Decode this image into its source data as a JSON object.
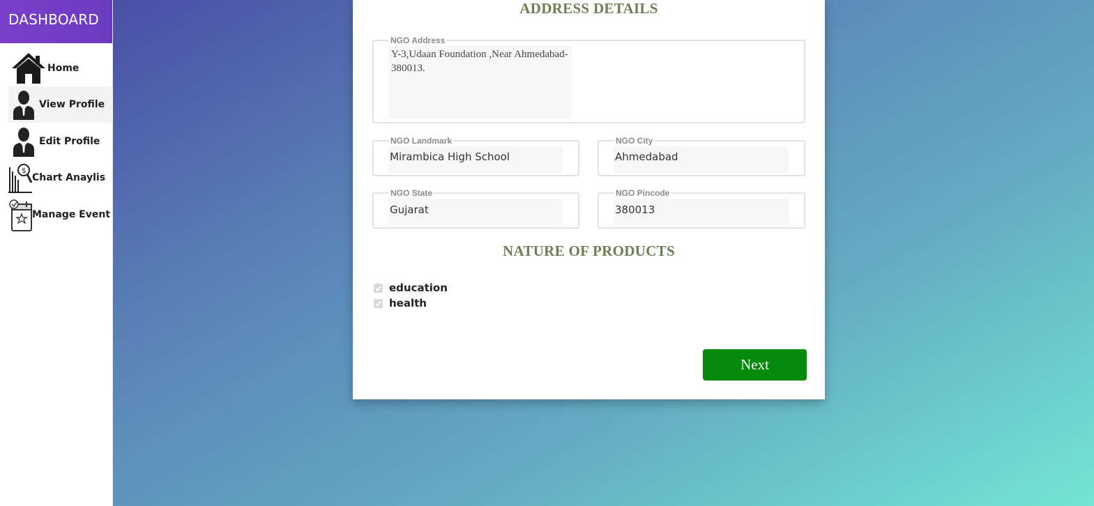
{
  "sidebar": {
    "title": "DASHBOARD",
    "items": [
      {
        "label": "Home",
        "icon": "house-icon"
      },
      {
        "label": "View Profile",
        "icon": "user-icon"
      },
      {
        "label": "Edit Profile",
        "icon": "user-icon"
      },
      {
        "label": "Chart Anaylis",
        "icon": "chart-analysis-icon"
      },
      {
        "label": "Manage Event",
        "icon": "calendar-icon"
      }
    ],
    "active": "View Profile"
  },
  "form": {
    "address_section_title": "ADDRESS DETAILS",
    "address": {
      "label": "NGO Address",
      "value": "Y-3,Udaan Foundation ,Near Ahmedabad-380013."
    },
    "landmark": {
      "label": "NGO Landmark",
      "value": "Mirambica High School"
    },
    "city": {
      "label": "NGO City",
      "value": "Ahmedabad"
    },
    "state": {
      "label": "NGO State",
      "value": "Gujarat"
    },
    "pincode": {
      "label": "NGO Pincode",
      "value": "380013"
    },
    "products_section_title": "NATURE OF PRODUCTS",
    "products": [
      {
        "label": "education",
        "checked": true
      },
      {
        "label": "health",
        "checked": true
      }
    ],
    "next_label": "Next"
  },
  "colors": {
    "sidebar_header": "#6a3bc0",
    "section_title": "#6b7f52",
    "next_button": "#058a0b"
  }
}
